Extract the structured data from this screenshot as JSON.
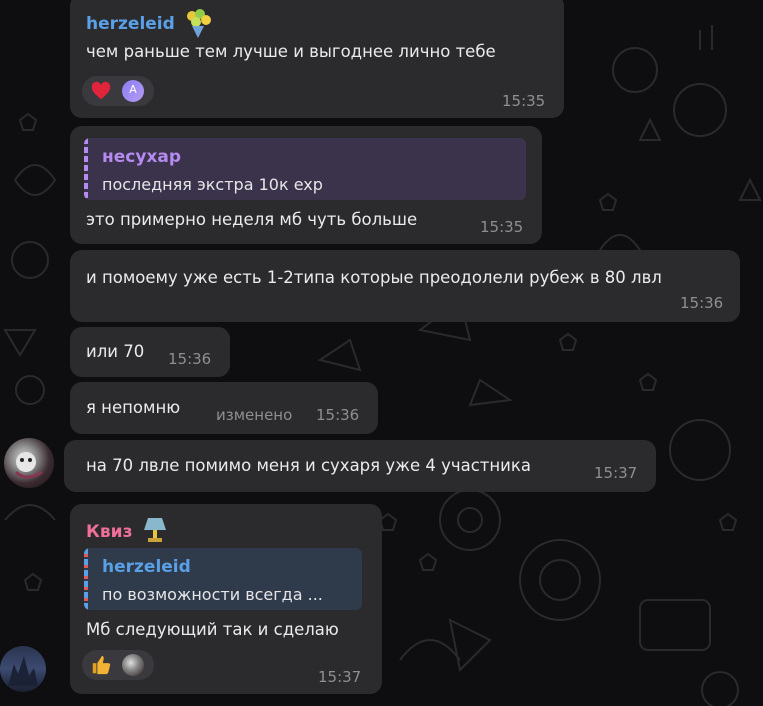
{
  "messages": {
    "m1": {
      "sender": "herzeleid",
      "text": "чем раньше тем лучше и выгоднее лично тебе",
      "time": "15:35",
      "avatar_letter": "A"
    },
    "m2": {
      "quote_name": "несухар",
      "quote_text": "последняя экстра 10к exp",
      "text": "это примерно неделя мб чуть больше",
      "time": "15:35"
    },
    "m3": {
      "text": "и помоему уже есть 1-2типа которые преодолели рубеж в 80 лвл",
      "time": "15:36"
    },
    "m4": {
      "text": "или 70",
      "time": "15:36"
    },
    "m5": {
      "text": "я непомню",
      "edited": "изменено",
      "time": "15:36"
    },
    "m6": {
      "text": "на 70 лвле помимо меня и сухаря уже 4 участника",
      "time": "15:37"
    },
    "m7": {
      "sender": "Квиз",
      "quote_name": "herzeleid",
      "quote_text": "по возможности всегда ...",
      "text": "Мб следующий так и сделаю",
      "time": "15:37"
    }
  },
  "colors": {
    "bubble": "#2b2b2e",
    "herzeleid_name": "#5aa0e6",
    "nesuhar_name": "#b68bf0",
    "kviz_name": "#ee6f98",
    "heart": "#e0243c",
    "thumbs": "#f2b233"
  },
  "icons": [
    "heart-icon",
    "thumbs-up-icon",
    "bouquet-icon",
    "lamp-icon",
    "avatar-letter"
  ]
}
